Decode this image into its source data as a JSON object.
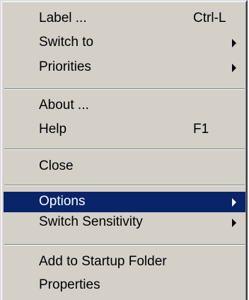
{
  "menu": {
    "items": [
      {
        "label": "Label ...",
        "shortcut": "Ctrl-L"
      },
      {
        "label": "Switch to",
        "submenu": true
      },
      {
        "label": "Priorities",
        "submenu": true
      },
      {
        "label": "About ..."
      },
      {
        "label": "Help",
        "shortcut": "F1"
      },
      {
        "label": "Close"
      },
      {
        "label": "Options",
        "submenu": true,
        "selected": true
      },
      {
        "label": "Switch Sensitivity",
        "submenu": true
      },
      {
        "label": "Add to Startup Folder"
      },
      {
        "label": "Properties"
      }
    ]
  },
  "colors": {
    "menu_background": "#d4d0c8",
    "selection_background": "#0a246a",
    "selection_text": "#ffffff",
    "text": "#000000"
  }
}
